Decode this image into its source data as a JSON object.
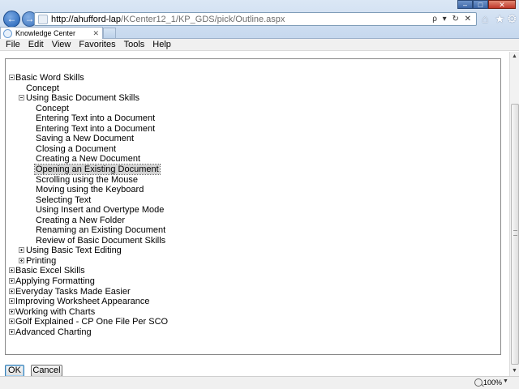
{
  "browser": {
    "window_controls": [
      "–",
      "□",
      "✕"
    ],
    "address": {
      "host": "http://ahufford-lap",
      "path": "/KCenter12_1/KP_GDS/pick/Outline.aspx",
      "tools": "ρ ▾ ↻ ✕"
    },
    "tab": {
      "title": "Knowledge Center",
      "close": "✕"
    },
    "icons": {
      "back": "back-arrow-icon",
      "forward": "forward-arrow-icon",
      "home": "home-icon",
      "favorites": "star-icon",
      "tools": "gear-icon"
    }
  },
  "menu": [
    "File",
    "Edit",
    "View",
    "Favorites",
    "Tools",
    "Help"
  ],
  "tree": [
    {
      "label": "Basic Word Skills",
      "level": 0,
      "toggle": "expanded"
    },
    {
      "label": "Concept",
      "level": 1,
      "toggle": "none"
    },
    {
      "label": "Using Basic Document Skills",
      "level": 1,
      "toggle": "expanded"
    },
    {
      "label": "Concept",
      "level": 2,
      "toggle": "none"
    },
    {
      "label": "Entering Text into a Document",
      "level": 2,
      "toggle": "none"
    },
    {
      "label": "Entering Text into a Document",
      "level": 2,
      "toggle": "none"
    },
    {
      "label": "Saving a New Document",
      "level": 2,
      "toggle": "none"
    },
    {
      "label": "Closing a Document",
      "level": 2,
      "toggle": "none"
    },
    {
      "label": "Creating a New Document",
      "level": 2,
      "toggle": "none"
    },
    {
      "label": "Opening an Existing Document",
      "level": 2,
      "toggle": "none",
      "selected": true
    },
    {
      "label": "Scrolling using the Mouse",
      "level": 2,
      "toggle": "none"
    },
    {
      "label": "Moving using the Keyboard",
      "level": 2,
      "toggle": "none"
    },
    {
      "label": "Selecting Text",
      "level": 2,
      "toggle": "none"
    },
    {
      "label": "Using Insert and Overtype Mode",
      "level": 2,
      "toggle": "none"
    },
    {
      "label": "Creating a New Folder",
      "level": 2,
      "toggle": "none"
    },
    {
      "label": "Renaming an Existing Document",
      "level": 2,
      "toggle": "none"
    },
    {
      "label": "Review of Basic Document Skills",
      "level": 2,
      "toggle": "none"
    },
    {
      "label": "Using Basic Text Editing",
      "level": 1,
      "toggle": "collapsed"
    },
    {
      "label": "Printing",
      "level": 1,
      "toggle": "collapsed"
    },
    {
      "label": "Basic Excel Skills",
      "level": 0,
      "toggle": "collapsed"
    },
    {
      "label": "Applying Formatting",
      "level": 0,
      "toggle": "collapsed"
    },
    {
      "label": "Everyday Tasks Made Easier",
      "level": 0,
      "toggle": "collapsed"
    },
    {
      "label": "Improving Worksheet Appearance",
      "level": 0,
      "toggle": "collapsed"
    },
    {
      "label": "Working with Charts",
      "level": 0,
      "toggle": "collapsed"
    },
    {
      "label": "Golf Explained - CP One File Per SCO",
      "level": 0,
      "toggle": "collapsed"
    },
    {
      "label": "Advanced Charting",
      "level": 0,
      "toggle": "collapsed"
    }
  ],
  "buttons": {
    "ok": "OK",
    "cancel": "Cancel"
  },
  "status": {
    "zoom": "100%",
    "zoom_arrow": "▼"
  },
  "scrollbar": {
    "up": "▲",
    "down": "▼"
  }
}
